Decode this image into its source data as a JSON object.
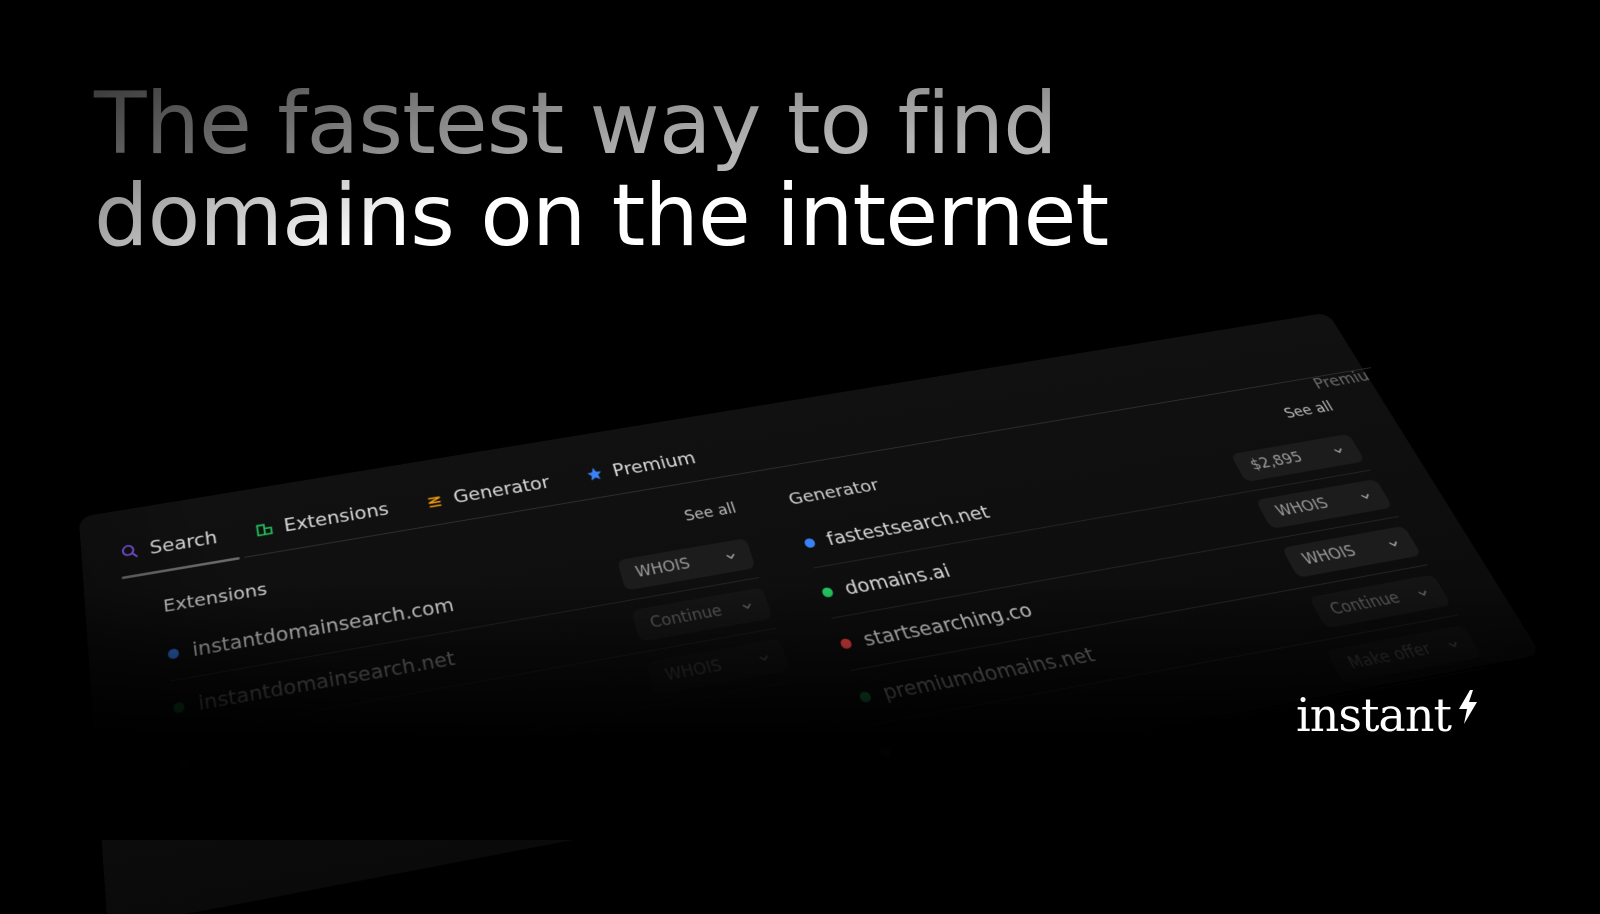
{
  "hero": {
    "line1": "The fastest way to find",
    "line2": "domains on the internet"
  },
  "tabs": [
    {
      "label": "Search",
      "icon": "search-icon",
      "color": "#8b5cf6"
    },
    {
      "label": "Extensions",
      "icon": "extensions-icon",
      "color": "#22c55e"
    },
    {
      "label": "Generator",
      "icon": "generator-icon",
      "color": "#f59e0b"
    },
    {
      "label": "Premium",
      "icon": "premium-icon",
      "color": "#3b82f6"
    }
  ],
  "left": {
    "title": "Extensions",
    "see_all": "See all",
    "rows": [
      {
        "name": "instantdomainsearch.com",
        "dot": "#3b82f6",
        "action": "WHOIS"
      },
      {
        "name": "instantdomainsearch.net",
        "dot": "#22c55e",
        "action": "Continue"
      },
      {
        "name": "",
        "dot": "#22c55e",
        "action": "WHOIS"
      }
    ]
  },
  "right": {
    "title": "Generator",
    "see_all": "See all",
    "extra_title": "Premiu",
    "rows": [
      {
        "name": "fastestsearch.net",
        "dot": "#3b82f6",
        "action": "$2,895"
      },
      {
        "name": "domains.ai",
        "dot": "#22c55e",
        "action": "WHOIS"
      },
      {
        "name": "startsearching.co",
        "dot": "#ef4444",
        "action": "WHOIS"
      },
      {
        "name": "premiumdomains.net",
        "dot": "#22c55e",
        "action": "Continue"
      },
      {
        "name": "",
        "dot": "#22c55e",
        "action": "Make offer"
      }
    ]
  },
  "logo": {
    "text": "instant",
    "icon": "lightning-icon"
  }
}
